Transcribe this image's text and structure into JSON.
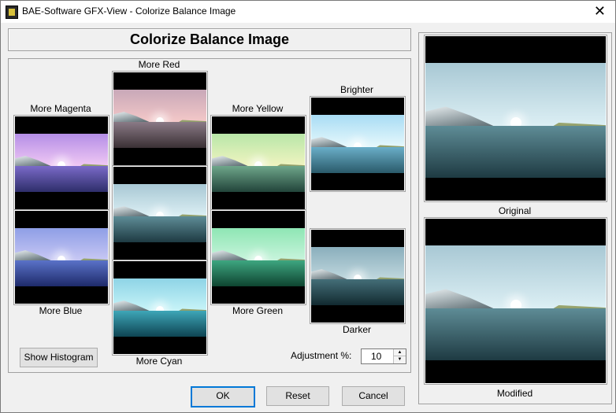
{
  "window": {
    "title": "BAE-Software GFX-View - Colorize Balance Image",
    "close_glyph": "✕",
    "icon": "app-icon"
  },
  "header": {
    "title": "Colorize Balance Image"
  },
  "labels": {
    "more_magenta": "More Magenta",
    "more_blue": "More Blue",
    "more_red": "More Red",
    "more_cyan": "More Cyan",
    "more_yellow": "More Yellow",
    "more_green": "More Green",
    "brighter": "Brighter",
    "darker": "Darker",
    "original": "Original",
    "modified": "Modified"
  },
  "adjustment": {
    "label": "Adjustment %:",
    "value": "10"
  },
  "buttons": {
    "show_histogram": "Show Histogram",
    "ok": "OK",
    "reset": "Reset",
    "cancel": "Cancel"
  },
  "colors": {
    "accent": "#0078d7",
    "panel_bg": "#f0f0f0"
  }
}
